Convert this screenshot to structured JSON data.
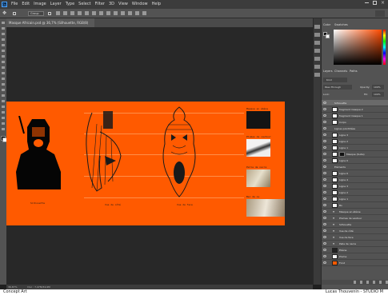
{
  "menu": {
    "app_logo": "Ps",
    "items": [
      "File",
      "Edit",
      "Image",
      "Layer",
      "Type",
      "Select",
      "Filter",
      "3D",
      "View",
      "Window",
      "Help"
    ]
  },
  "options_bar": {
    "auto_select": "Group"
  },
  "document": {
    "tab_title": "Masque Africain.psd @ 36,7% (Silhouette, RGB/8)",
    "labels": {
      "silhouette": "Silhouette",
      "side_view": "Vue de côté",
      "front_view": "Vue de face"
    },
    "captions": [
      "Masque en ébène",
      "Plumes de vautour",
      "Pelle de nacre",
      "Bec de nu"
    ]
  },
  "status": {
    "zoom": "36,67%",
    "doc_info": "Doc : 7,47M/34,9M"
  },
  "footer": {
    "left": "Concept Art",
    "right": "Lucas Thouvenin - STUDIO M"
  },
  "right_panel": {
    "tabs_top": [
      "Color",
      "Swatches"
    ],
    "tabs_layers": [
      "Layers",
      "Channels",
      "Paths"
    ],
    "kind_filter": "Kind",
    "blend_mode": "Pass Through",
    "opacity_label": "Opacity:",
    "opacity_value": "100%",
    "lock_label": "Lock:",
    "fill_label": "Fill:",
    "fill_value": "100%",
    "colors": {
      "foreground": "#111111",
      "background": "#ffffff",
      "picker_hue": "#ff4b00"
    },
    "layers": [
      {
        "name": "Silhouette",
        "kind": "group"
      },
      {
        "name": "fragment masque 2",
        "kind": "layer"
      },
      {
        "name": "fragment masque 1",
        "kind": "layer"
      },
      {
        "name": "Corps",
        "kind": "layer"
      },
      {
        "name": "Lignes pointillées",
        "kind": "group"
      },
      {
        "name": "Ligne 3",
        "kind": "layer"
      },
      {
        "name": "Ligne 2",
        "kind": "layer"
      },
      {
        "name": "Ligne 1",
        "kind": "layer"
      },
      {
        "name": "Masque (Suite)",
        "kind": "layer"
      },
      {
        "name": "Ligne 0",
        "kind": "layer"
      },
      {
        "name": "Éléments",
        "kind": "group"
      },
      {
        "name": "Ligne 6",
        "kind": "layer"
      },
      {
        "name": "Ligne 4",
        "kind": "layer"
      },
      {
        "name": "Ligne 3",
        "kind": "layer"
      },
      {
        "name": "Ligne 2",
        "kind": "layer"
      },
      {
        "name": "Ligne 1",
        "kind": "layer"
      },
      {
        "name": "Bo",
        "kind": "layer"
      },
      {
        "name": "Masque en ébène",
        "kind": "text"
      },
      {
        "name": "Plumes de vautour",
        "kind": "text"
      },
      {
        "name": "Silhouette",
        "kind": "text"
      },
      {
        "name": "Vue de côté",
        "kind": "text"
      },
      {
        "name": "Vue de face",
        "kind": "text"
      },
      {
        "name": "Pelle de nacre",
        "kind": "text"
      },
      {
        "name": "Ébène",
        "kind": "layer"
      },
      {
        "name": "Plume",
        "kind": "layer"
      },
      {
        "name": "Fond",
        "kind": "layer"
      }
    ]
  }
}
